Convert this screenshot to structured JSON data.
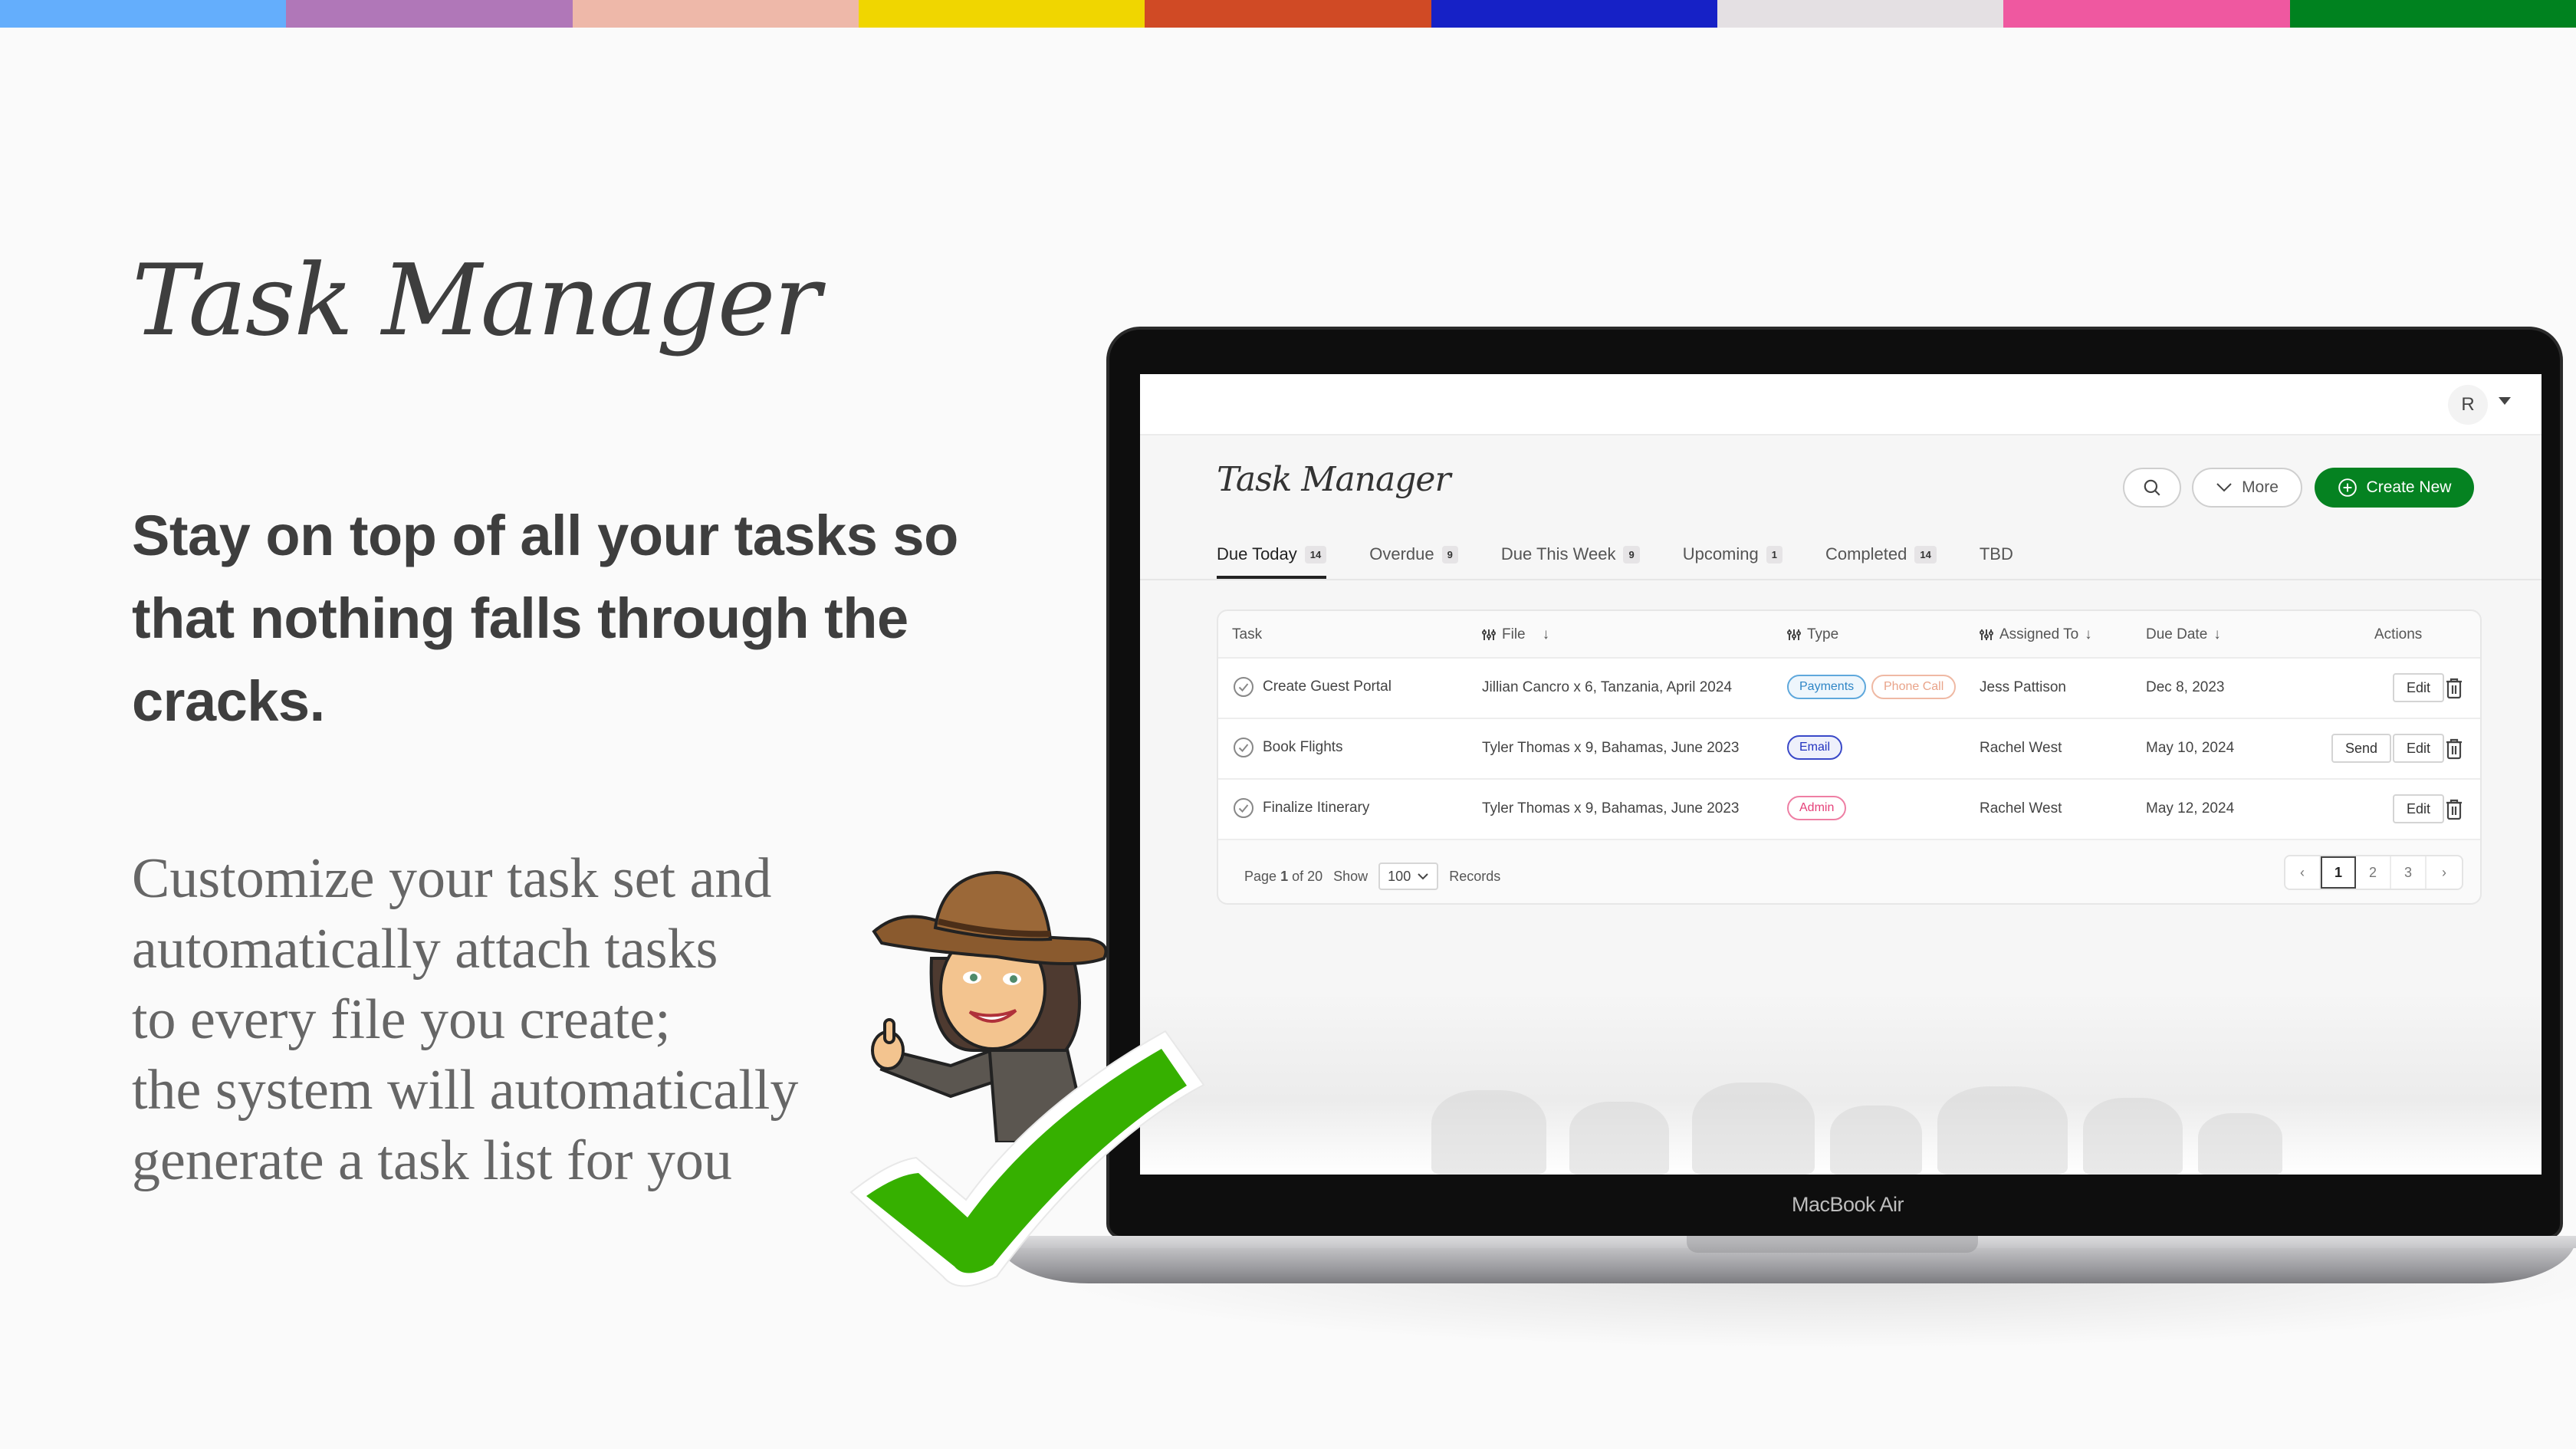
{
  "stripe_colors": [
    "#64aefc",
    "#b077b8",
    "#eeb8a9",
    "#f0d600",
    "#d04a25",
    "#1621c6",
    "#e4e0e3",
    "#ef58a0",
    "#00821f"
  ],
  "hero": {
    "title": "Task Manager",
    "subtitle": "Stay on top of all your tasks so that nothing falls through the cracks.",
    "body_lines": [
      "Customize your task set and",
      "automatically attach tasks",
      "to every file you create;",
      "the system will automatically",
      "generate a task list for you"
    ]
  },
  "laptop": {
    "label": "MacBook Air"
  },
  "app": {
    "user_initial": "R",
    "title": "Task Manager",
    "buttons": {
      "search": "search-icon",
      "more": "More",
      "create": "Create New"
    },
    "accent_color": "#058221",
    "tabs": [
      {
        "label": "Due Today",
        "count": "14",
        "active": true
      },
      {
        "label": "Overdue",
        "count": "9"
      },
      {
        "label": "Due This Week",
        "count": "9"
      },
      {
        "label": "Upcoming",
        "count": "1"
      },
      {
        "label": "Completed",
        "count": "14"
      },
      {
        "label": "TBD",
        "count": null
      }
    ],
    "table": {
      "headers": {
        "task": "Task",
        "file": "File",
        "type": "Type",
        "assigned": "Assigned To",
        "due": "Due Date",
        "actions": "Actions"
      },
      "rows": [
        {
          "task": "Create Guest Portal",
          "file": "Jillian Cancro x 6, Tanzania, April 2024",
          "tags": [
            "Payments",
            "Phone Call"
          ],
          "assigned": "Jess Pattison",
          "due": "Dec 8, 2023",
          "actions": [
            "Edit"
          ]
        },
        {
          "task": "Book Flights",
          "file": "Tyler Thomas x 9, Bahamas, June 2023",
          "tags": [
            "Email"
          ],
          "assigned": "Rachel West",
          "due": "May 10, 2024",
          "actions": [
            "Send",
            "Edit"
          ]
        },
        {
          "task": "Finalize Itinerary",
          "file": "Tyler Thomas x 9, Bahamas, June 2023",
          "tags": [
            "Admin"
          ],
          "assigned": "Rachel West",
          "due": "May 12, 2024",
          "actions": [
            "Edit"
          ]
        }
      ],
      "tag_colors": {
        "Payments": "#2f86c6",
        "Phone Call": "#e9a48a",
        "Email": "#2233c0",
        "Admin": "#e5417a"
      }
    },
    "pagination": {
      "page_label": "Page",
      "current_page": "1",
      "of_label": "of 20",
      "show_label": "Show",
      "page_size": "100",
      "records_label": "Records",
      "pages": [
        "1",
        "2",
        "3"
      ]
    }
  }
}
